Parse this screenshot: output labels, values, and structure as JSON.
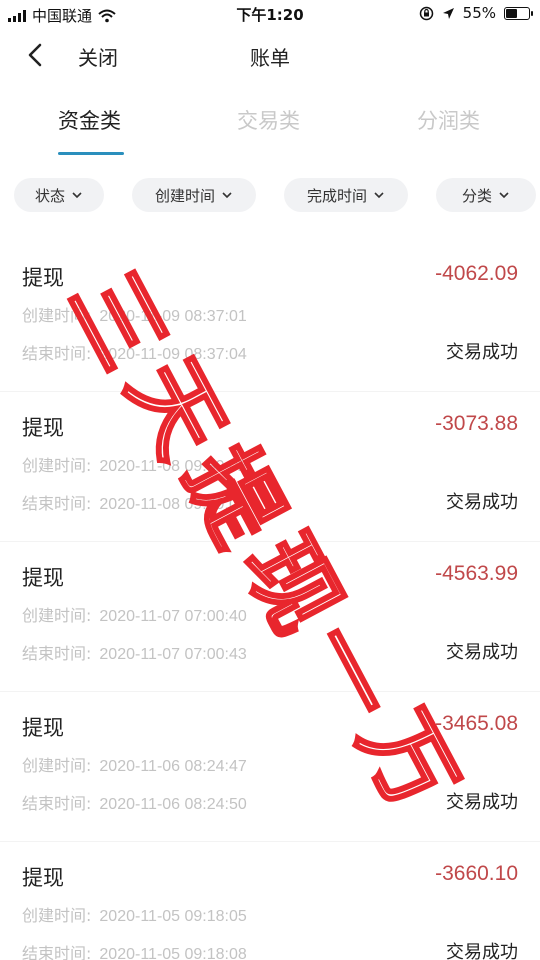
{
  "status_bar": {
    "carrier": "中国联通",
    "time": "下午1:20",
    "battery": "55%",
    "battery_level": 0.55
  },
  "nav": {
    "close_label": "关闭",
    "title": "账单"
  },
  "tabs": [
    {
      "label": "资金类",
      "active": true
    },
    {
      "label": "交易类",
      "active": false
    },
    {
      "label": "分润类",
      "active": false
    }
  ],
  "filters": [
    {
      "label": "状态"
    },
    {
      "label": "创建时间"
    },
    {
      "label": "完成时间"
    },
    {
      "label": "分类"
    }
  ],
  "labels": {
    "created": "创建时间:",
    "ended": "结束时间:"
  },
  "records": [
    {
      "title": "提现",
      "amount": "-4062.09",
      "created": "2020-11-09 08:37:01",
      "ended": "2020-11-09 08:37:04",
      "status": "交易成功"
    },
    {
      "title": "提现",
      "amount": "-3073.88",
      "created": "2020-11-08 09:39:02",
      "ended": "2020-11-08 09:39:06",
      "status": "交易成功"
    },
    {
      "title": "提现",
      "amount": "-4563.99",
      "created": "2020-11-07 07:00:40",
      "ended": "2020-11-07 07:00:43",
      "status": "交易成功"
    },
    {
      "title": "提现",
      "amount": "-3465.08",
      "created": "2020-11-06 08:24:47",
      "ended": "2020-11-06 08:24:50",
      "status": "交易成功"
    },
    {
      "title": "提现",
      "amount": "-3660.10",
      "created": "2020-11-05 09:18:05",
      "ended": "2020-11-05 09:18:08",
      "status": "交易成功"
    }
  ],
  "watermark": {
    "text": "三天提现一万",
    "color": "#e8262d"
  },
  "colors": {
    "accent": "#2a8fbd",
    "amount": "#c0484a"
  }
}
